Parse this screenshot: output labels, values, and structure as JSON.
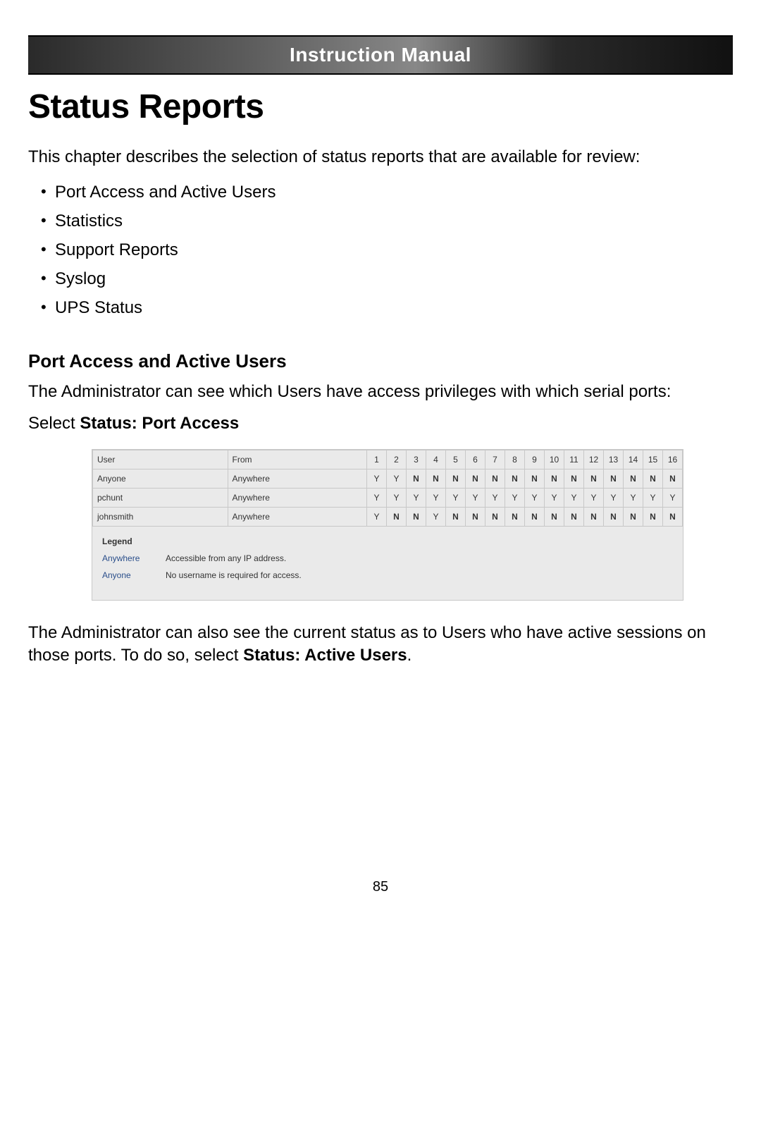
{
  "header": {
    "title": "Instruction Manual"
  },
  "chapter_title": "Status Reports",
  "intro": "This chapter describes the selection of status reports that are available for review:",
  "bullets": [
    "Port Access and Active Users",
    "Statistics",
    "Support Reports",
    "Syslog",
    "UPS Status"
  ],
  "section": {
    "heading": "Port Access and Active Users",
    "body": "The Administrator can see which Users have access privileges with which serial ports:",
    "select_prefix": "Select ",
    "select_bold": "Status: Port Access"
  },
  "table": {
    "headers": [
      "User",
      "From",
      "1",
      "2",
      "3",
      "4",
      "5",
      "6",
      "7",
      "8",
      "9",
      "10",
      "11",
      "12",
      "13",
      "14",
      "15",
      "16"
    ],
    "rows": [
      {
        "user": "Anyone",
        "from": "Anywhere",
        "cells": [
          "Y",
          "Y",
          "N",
          "N",
          "N",
          "N",
          "N",
          "N",
          "N",
          "N",
          "N",
          "N",
          "N",
          "N",
          "N",
          "N"
        ]
      },
      {
        "user": "pchunt",
        "from": "Anywhere",
        "cells": [
          "Y",
          "Y",
          "Y",
          "Y",
          "Y",
          "Y",
          "Y",
          "Y",
          "Y",
          "Y",
          "Y",
          "Y",
          "Y",
          "Y",
          "Y",
          "Y"
        ]
      },
      {
        "user": "johnsmith",
        "from": "Anywhere",
        "cells": [
          "Y",
          "N",
          "N",
          "Y",
          "N",
          "N",
          "N",
          "N",
          "N",
          "N",
          "N",
          "N",
          "N",
          "N",
          "N",
          "N"
        ]
      }
    ]
  },
  "legend": {
    "title": "Legend",
    "items": [
      {
        "term": "Anywhere",
        "def": "Accessible from any IP address."
      },
      {
        "term": "Anyone",
        "def": "No username is required for access."
      }
    ]
  },
  "follow": {
    "text_before": "The Administrator can also see the current status as to Users who have active sessions on those ports.  To do so, select ",
    "bold": "Status: Active Users",
    "text_after": "."
  },
  "page_number": "85"
}
